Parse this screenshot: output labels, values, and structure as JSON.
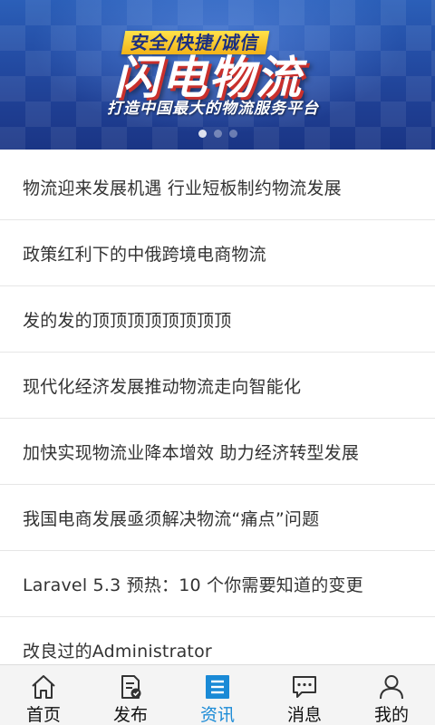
{
  "banner": {
    "slogan": "安全/快捷/诚信",
    "title": "闪电物流",
    "subtitle": "打造中国最大的物流服务平台",
    "slide_count": 3,
    "active_slide": 1
  },
  "news": {
    "items": [
      {
        "title": "物流迎来发展机遇 行业短板制约物流发展"
      },
      {
        "title": "政策红利下的中俄跨境电商物流"
      },
      {
        "title": "发的发的顶顶顶顶顶顶顶顶"
      },
      {
        "title": "现代化经济发展推动物流走向智能化"
      },
      {
        "title": "加快实现物流业降本增效 助力经济转型发展"
      },
      {
        "title": "我国电商发展亟须解决物流“痛点”问题"
      },
      {
        "title": "Laravel 5.3 预热：10 个你需要知道的变更"
      },
      {
        "title": "改良过的Administrator"
      }
    ]
  },
  "tabbar": {
    "tabs": [
      {
        "label": "首页",
        "icon": "home-icon"
      },
      {
        "label": "发布",
        "icon": "publish-icon"
      },
      {
        "label": "资讯",
        "icon": "news-icon",
        "active": true
      },
      {
        "label": "消息",
        "icon": "message-icon"
      },
      {
        "label": "我的",
        "icon": "profile-icon"
      }
    ]
  },
  "colors": {
    "active_tab": "#1a8ad6",
    "banner_blue": "#244ea6",
    "slogan_yellow": "#ffe24a"
  }
}
